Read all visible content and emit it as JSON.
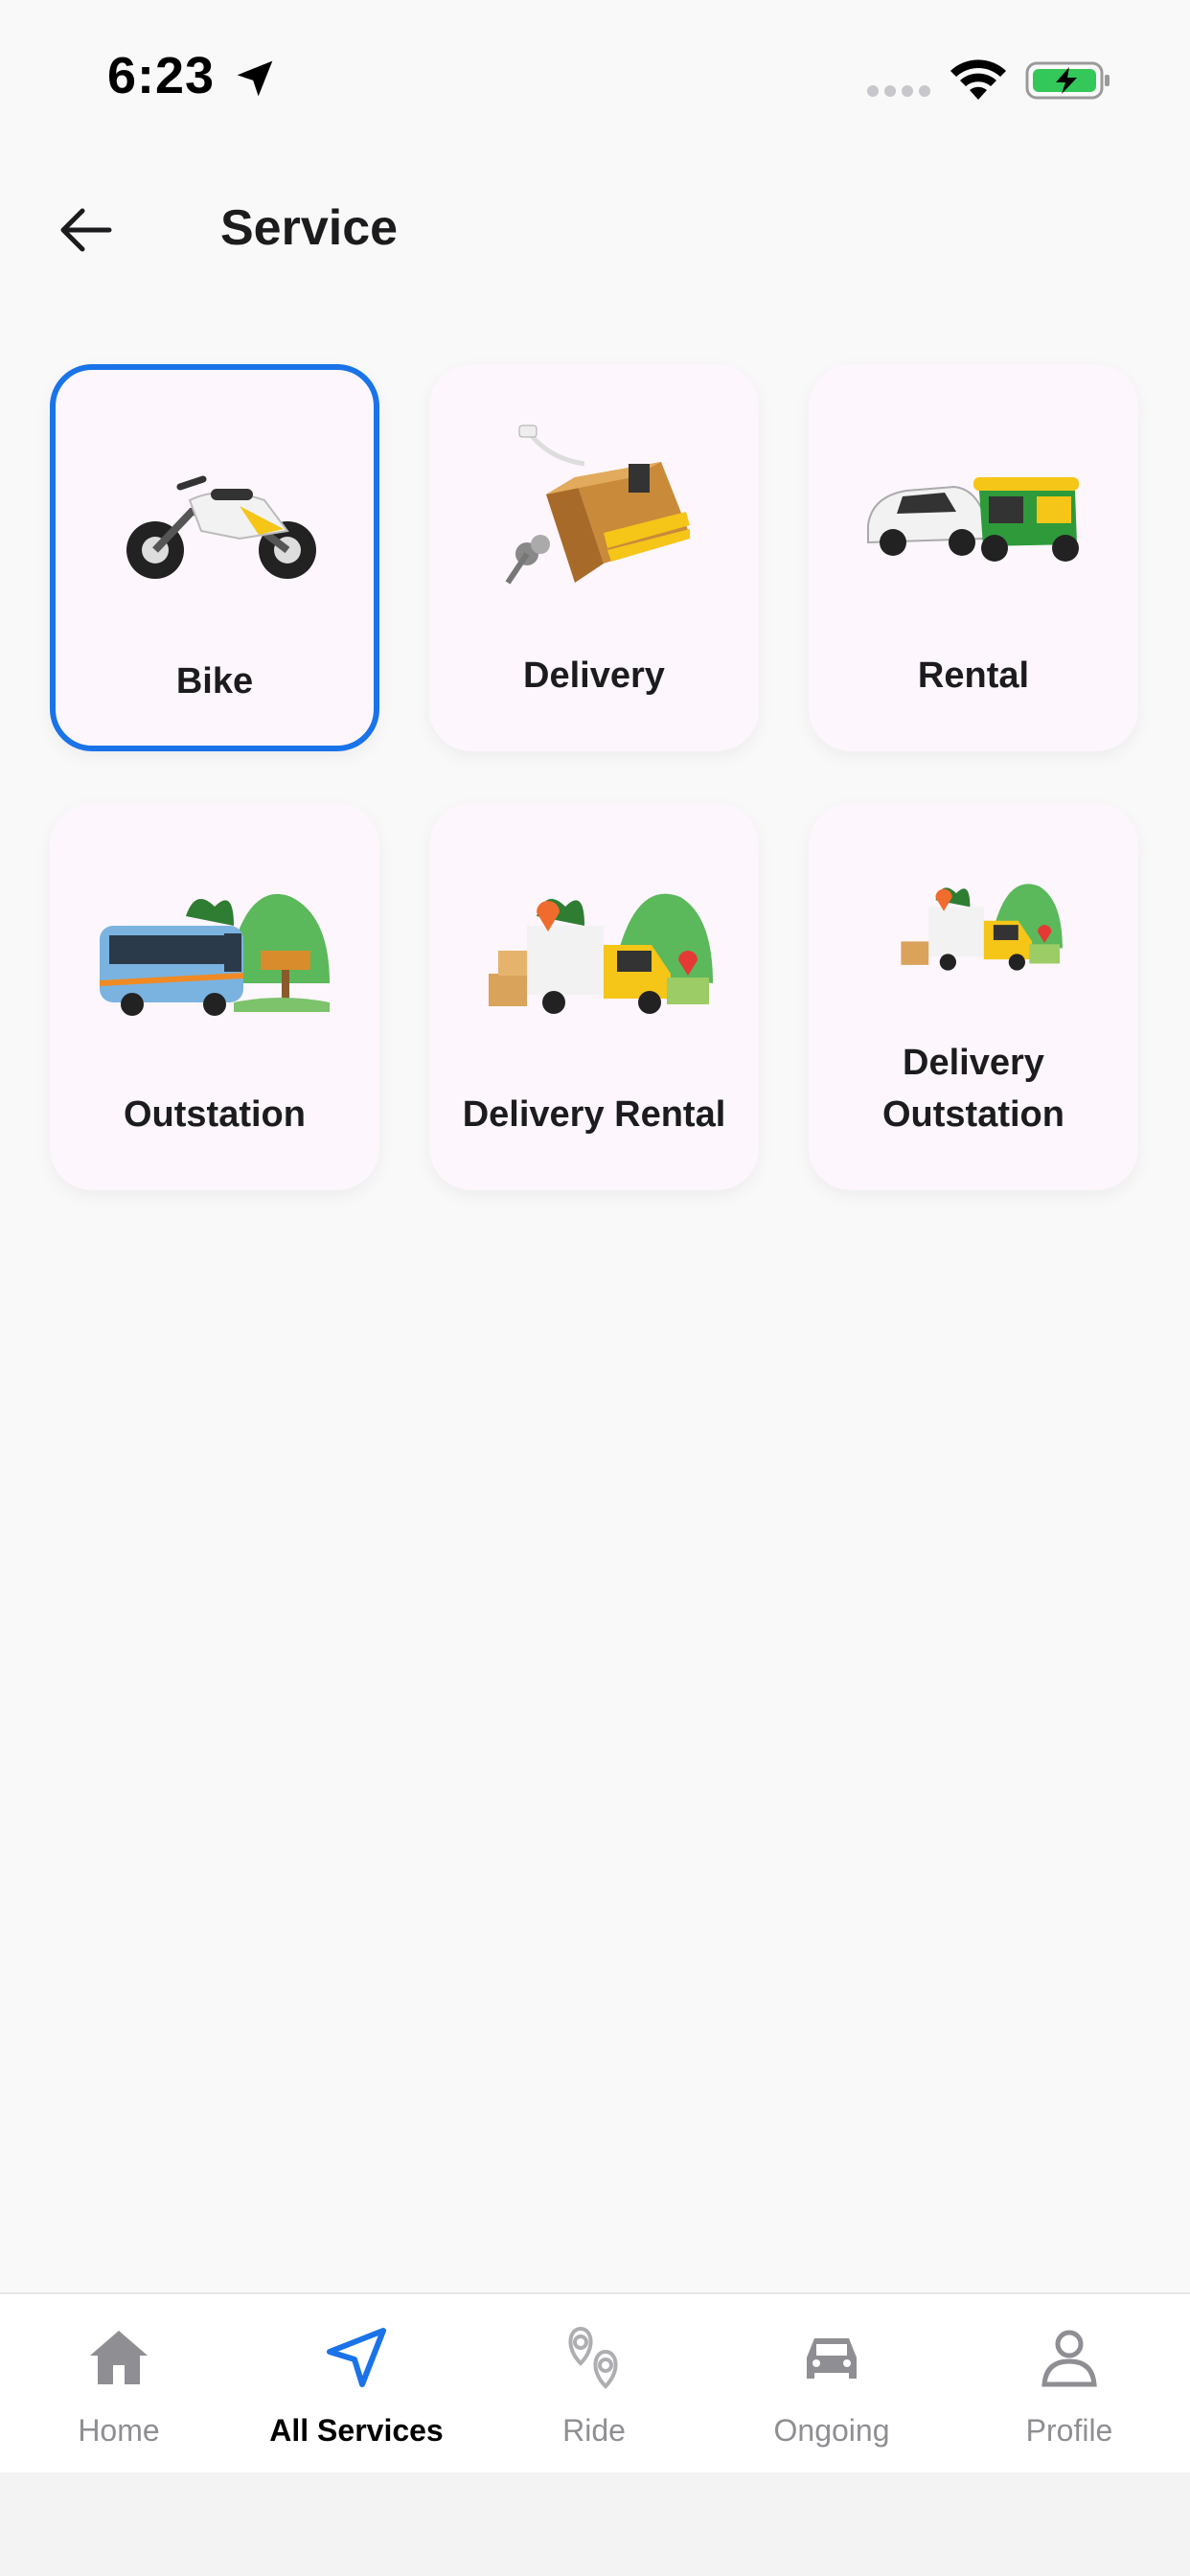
{
  "status_bar": {
    "time": "6:23",
    "icons": [
      "location-arrow-icon",
      "cellular-signal-icon",
      "wifi-icon",
      "battery-charging-icon"
    ],
    "battery_color": "#34c759"
  },
  "header": {
    "back_icon": "back-arrow-icon",
    "title": "Service"
  },
  "services": [
    {
      "id": "bike",
      "label": "Bike",
      "icon": "motorbike-icon",
      "selected": true
    },
    {
      "id": "delivery",
      "label": "Delivery",
      "icon": "parcel-delivery-icon",
      "selected": false
    },
    {
      "id": "rental",
      "label": "Rental",
      "icon": "car-and-auto-rickshaw-icon",
      "selected": false
    },
    {
      "id": "outstation",
      "label": "Outstation",
      "icon": "bus-scenery-icon",
      "selected": false
    },
    {
      "id": "delivery_rental",
      "label": "Delivery Rental",
      "icon": "delivery-truck-scenery-icon",
      "selected": false
    },
    {
      "id": "delivery_outstation",
      "label_line1": "Delivery",
      "label_line2": "Outstation",
      "icon": "delivery-truck-small-icon",
      "selected": false
    }
  ],
  "tabbar": {
    "tabs": [
      {
        "label": "Home",
        "icon": "home-icon",
        "active": false
      },
      {
        "label": "All Services",
        "icon": "navigation-arrow-icon",
        "active": true
      },
      {
        "label": "Ride",
        "icon": "map-pins-icon",
        "active": false
      },
      {
        "label": "Ongoing",
        "icon": "car-icon",
        "active": false
      },
      {
        "label": "Profile",
        "icon": "person-icon",
        "active": false
      }
    ]
  },
  "colors": {
    "accent": "#1a73e8",
    "card_bg": "#fdf6fc",
    "inactive_tab": "#8e8e93"
  }
}
